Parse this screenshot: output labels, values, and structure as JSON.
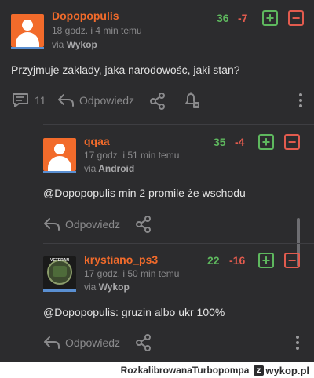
{
  "comments": [
    {
      "username": "Dopopopulis",
      "time": "18 godz. i 4 min temu",
      "via_label": "via",
      "via_source": "Wykop",
      "score_plus": "36",
      "score_minus": "-7",
      "text": "Przyjmuje zaklady, jaka narodowośc, jaki stan?",
      "replies_count": "11",
      "reply_label": "Odpowiedz"
    },
    {
      "username": "qqaa",
      "time": "17 godz. i 51 min temu",
      "via_label": "via",
      "via_source": "Android",
      "score_plus": "35",
      "score_minus": "-4",
      "mention": "@Dopopopulis",
      "text": " min 2 promile że wschodu",
      "reply_label": "Odpowiedz"
    },
    {
      "username": "krystiano_ps3",
      "time": "17 godz. i 50 min temu",
      "via_label": "via",
      "via_source": "Wykop",
      "score_plus": "22",
      "score_minus": "-16",
      "mention": "@Dopopopulis",
      "text": ": gruzin albo ukr 100%",
      "reply_label": "Odpowiedz",
      "avatar_text": "VETERAN"
    }
  ],
  "footer": {
    "author": "RozkalibrowanaTurbopompa",
    "badge_letter": "z",
    "brand": "wykop.pl"
  },
  "colors": {
    "background": "#2c2c2e",
    "username": "#f26b2b",
    "plus": "#5eb85e",
    "minus": "#e25b4e"
  }
}
